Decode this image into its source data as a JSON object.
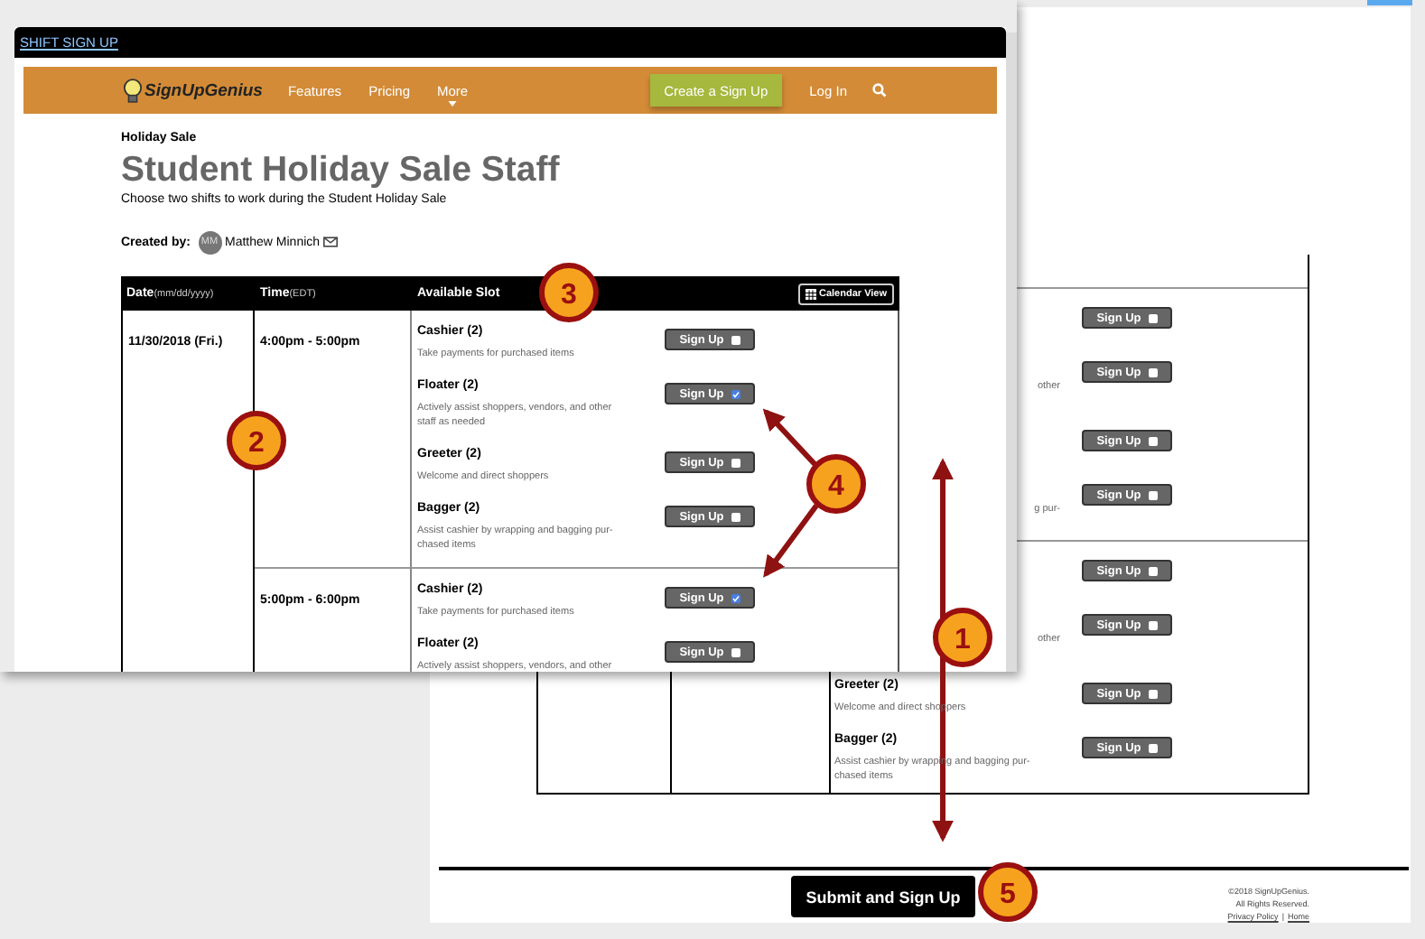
{
  "back_page": {
    "slot_groups": [
      {
        "slots": [
          {
            "button": "Sign Up",
            "checked": false
          },
          {
            "description": "other",
            "button": "Sign Up",
            "checked": false
          },
          {
            "button": "Sign Up",
            "checked": false
          },
          {
            "description": "g pur-",
            "button": "Sign Up",
            "checked": false
          }
        ]
      },
      {
        "slots": [
          {
            "button": "Sign Up",
            "checked": false
          },
          {
            "description": "other",
            "button": "Sign Up",
            "checked": false
          },
          {
            "name": "Greeter (2)",
            "description": "Welcome and direct shoppers",
            "button": "Sign Up",
            "checked": false
          },
          {
            "name": "Bagger (2)",
            "description": "Assist cashier by wrapping and bagging pur-chased items",
            "button": "Sign Up",
            "checked": false
          }
        ]
      }
    ],
    "submit_button": "Submit and Sign Up",
    "copyright": [
      "©2018 SignUpGenius.",
      "All Rights Reserved."
    ],
    "footer_links": [
      "Privacy Policy",
      "Home"
    ],
    "link_separator": "|"
  },
  "front_window": {
    "title_link": "SHIFT SIGN UP",
    "nav": {
      "logo": "SignUpGenius",
      "items": [
        {
          "label": "Features",
          "kind": "link"
        },
        {
          "label": "Pricing",
          "kind": "link"
        },
        {
          "label": "More",
          "kind": "dropdown"
        }
      ],
      "create_button": "Create a Sign Up",
      "login": "Log In"
    },
    "event_label": "Holiday Sale",
    "title": "Student Holiday Sale Staff",
    "description": "Choose two shifts to work during the Student Holiday Sale",
    "creator": {
      "label": "Created by:",
      "initials": "MM",
      "name": "Matthew Minnich"
    },
    "table": {
      "columns": [
        {
          "label": "Date",
          "hint": "(mm/dd/yyyy)"
        },
        {
          "label": "Time",
          "hint": "(EDT)"
        },
        {
          "label": "Available Slot"
        }
      ],
      "calendar_button": "Calendar View",
      "groups": [
        {
          "date": "11/30/2018 (Fri.)",
          "time": "4:00pm - 5:00pm",
          "slots": [
            {
              "name": "Cashier (2)",
              "description": "Take payments for purchased items",
              "button": "Sign Up",
              "checked": false
            },
            {
              "name": "Floater (2)",
              "description": "Actively assist shoppers, vendors, and other staff as needed",
              "button": "Sign Up",
              "checked": true
            },
            {
              "name": "Greeter (2)",
              "description": "Welcome and direct shoppers",
              "button": "Sign Up",
              "checked": false
            },
            {
              "name": "Bagger (2)",
              "description": "Assist cashier by wrapping and bagging pur-chased items",
              "button": "Sign Up",
              "checked": false
            }
          ]
        },
        {
          "time": "5:00pm - 6:00pm",
          "slots": [
            {
              "name": "Cashier (2)",
              "description": "Take payments for purchased items",
              "button": "Sign Up",
              "checked": true
            },
            {
              "name": "Floater (2)",
              "description": "Actively assist shoppers, vendors, and other",
              "button": "Sign Up",
              "checked": false
            }
          ]
        }
      ]
    }
  },
  "callouts": [
    {
      "number": "1"
    },
    {
      "number": "2"
    },
    {
      "number": "3"
    },
    {
      "number": "4"
    },
    {
      "number": "5"
    }
  ]
}
